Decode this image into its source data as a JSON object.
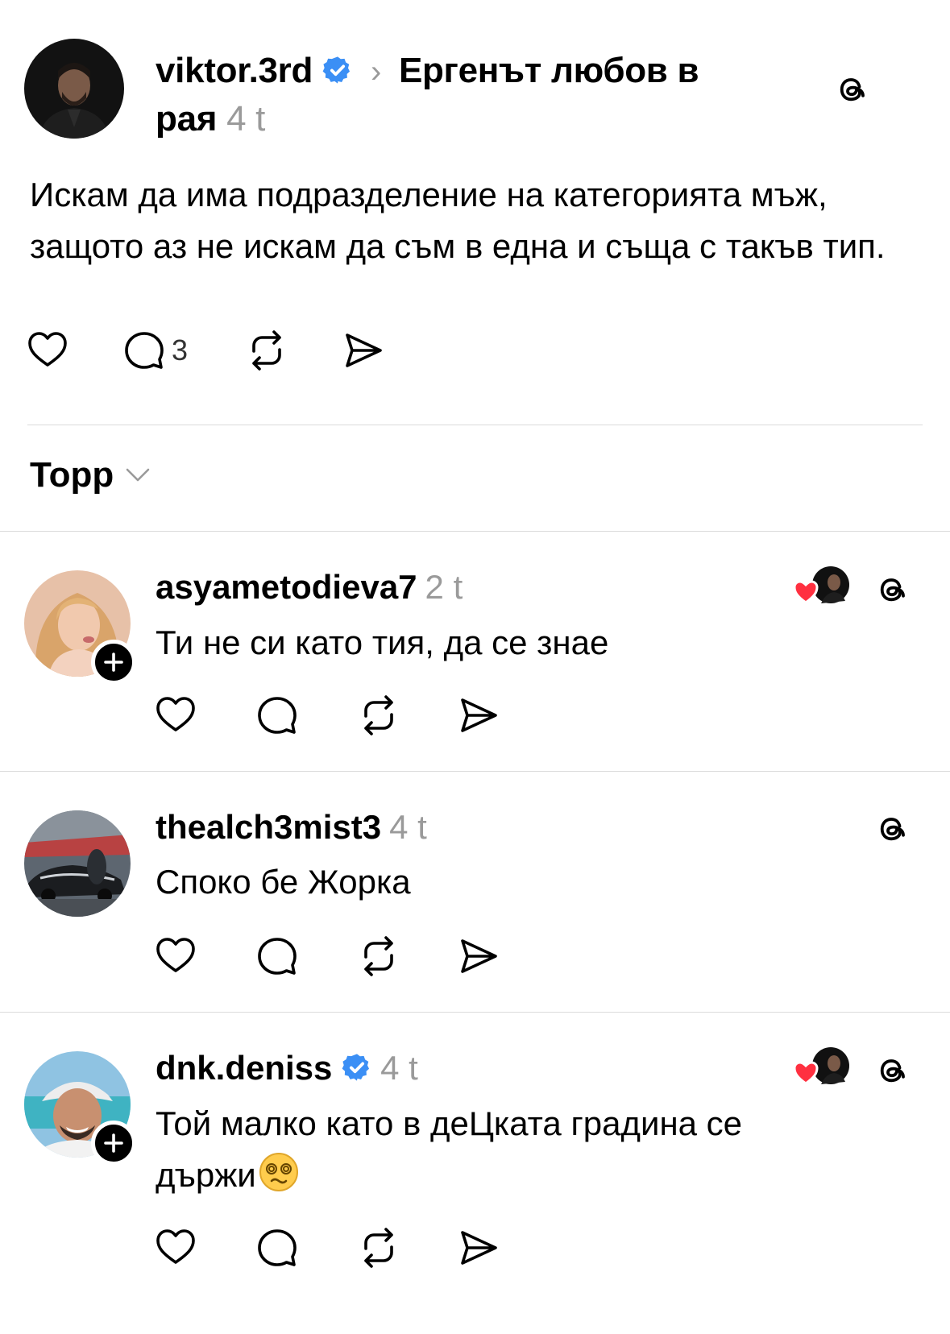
{
  "post": {
    "username": "viktor.3rd",
    "verified": true,
    "topic": "Ергенът любов в рая",
    "topic_line1": "Ергенът любов в",
    "topic_line2": "рая",
    "time": "4 t",
    "text": "Искам да има подразделение на категорията мъж, защото аз не искам да съм в една и съща с такъв тип.",
    "reply_count": "3"
  },
  "sort": {
    "label": "Topp"
  },
  "replies": [
    {
      "username": "asyametodieva7",
      "time": "2 t",
      "text": "Ти не си като тия, да се знае",
      "verified": false,
      "follow_badge": true,
      "liked_by_author": true
    },
    {
      "username": "thealch3mist3",
      "time": "4 t",
      "text": "Споко бе Жорка",
      "verified": false,
      "follow_badge": false,
      "liked_by_author": false
    },
    {
      "username": "dnk.deniss",
      "time": "4 t",
      "text": "Той малко като в деЦката градина се държи",
      "text_line1": "Той малко като в деЦката градина се",
      "text_line2": "държи",
      "emoji": "😵‍💫",
      "verified": true,
      "follow_badge": true,
      "liked_by_author": true
    }
  ],
  "icons": {
    "like": "heart-icon",
    "comment": "comment-bubble-icon",
    "repost": "repost-icon",
    "share": "send-icon",
    "app": "threads-logo-icon",
    "verified": "verified-badge-icon",
    "follow": "plus-icon",
    "sort": "chevron-down-icon"
  },
  "colors": {
    "verified": "#3b8ff5",
    "liked_heart": "#ff3040",
    "muted": "#9a9a9a",
    "divider": "#dbdbdb"
  }
}
